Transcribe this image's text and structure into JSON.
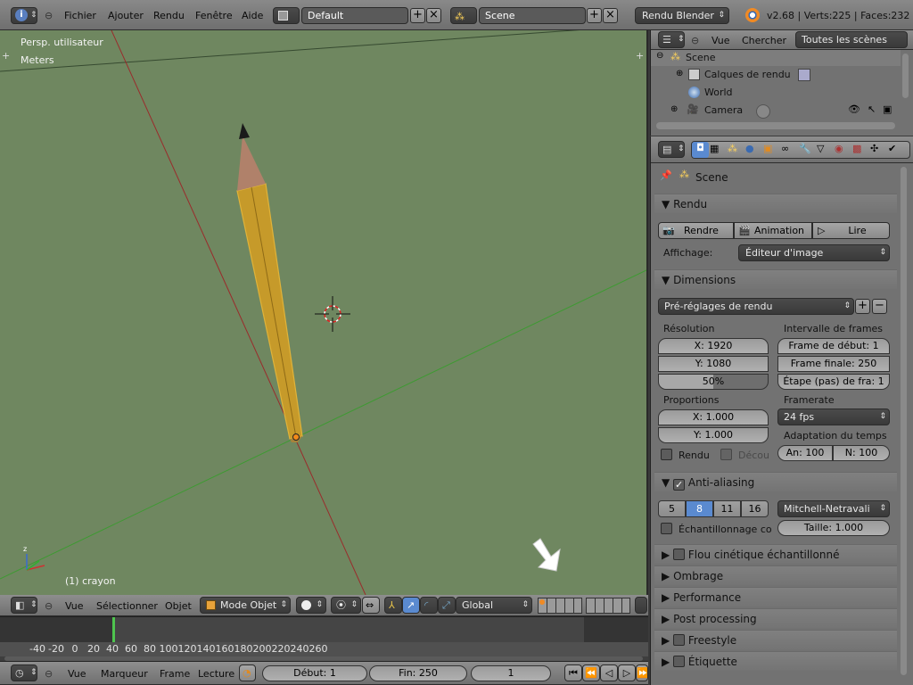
{
  "top_menu": {
    "items": [
      "Fichier",
      "Ajouter",
      "Rendu",
      "Fenêtre",
      "Aide"
    ],
    "layout": "Default",
    "scene": "Scene",
    "engine": "Rendu Blender",
    "version_stats": "v2.68 | Verts:225 | Faces:232"
  },
  "viewport": {
    "view_name": "Persp. utilisateur",
    "units": "Meters",
    "object_label": "(1) crayon"
  },
  "viewport_header": {
    "menus": [
      "Vue",
      "Sélectionner",
      "Objet"
    ],
    "mode": "Mode Objet",
    "orientation": "Global"
  },
  "timeline": {
    "ticks": [
      "-40",
      "-20",
      "0",
      "20",
      "40",
      "60",
      "80",
      "100",
      "120",
      "140",
      "160",
      "180",
      "200",
      "220",
      "240",
      "260"
    ],
    "current_frame_marker": 0
  },
  "timeline_header": {
    "menus": [
      "Vue",
      "Marqueur",
      "Frame",
      "Lecture"
    ],
    "start": "Début: 1",
    "end": "Fin: 250",
    "current": "1"
  },
  "outliner": {
    "menus": [
      "Vue",
      "Chercher"
    ],
    "filter": "Toutes les scènes",
    "items": [
      "Scene",
      "Calques de rendu",
      "World",
      "Camera"
    ]
  },
  "properties": {
    "context": "Scene",
    "render_panel": {
      "title": "Rendu",
      "render_btn": "Rendre",
      "animation_btn": "Animation",
      "play_btn": "Lire",
      "display_label": "Affichage:",
      "display_value": "Éditeur d'image"
    },
    "dimensions_panel": {
      "title": "Dimensions",
      "preset": "Pré-réglages de rendu",
      "resolution_label": "Résolution",
      "res_x": "X: 1920",
      "res_y": "Y: 1080",
      "res_pct": "50%",
      "frame_range_label": "Intervalle de frames",
      "frame_start": "Frame de début: 1",
      "frame_end": "Frame finale: 250",
      "frame_step": "Étape (pas) de fra: 1",
      "aspect_label": "Proportions",
      "aspect_x": "X: 1.000",
      "aspect_y": "Y: 1.000",
      "framerate_label": "Framerate",
      "framerate": "24 fps",
      "time_remap_label": "Adaptation du temps",
      "remap_old": "An: 100",
      "remap_new": "N: 100",
      "border_label": "Rendu",
      "crop_label": "Décou"
    },
    "aa_panel": {
      "title": "Anti-aliasing",
      "samples": [
        "5",
        "8",
        "11",
        "16"
      ],
      "selected_sample": "8",
      "filter": "Mitchell-Netravali",
      "full_sample": "Échantillonnage co",
      "size": "Taille: 1.000"
    },
    "collapsed_panels": [
      "Flou cinétique échantillonné",
      "Ombrage",
      "Performance",
      "Post processing",
      "Freestyle",
      "Étiquette"
    ]
  }
}
